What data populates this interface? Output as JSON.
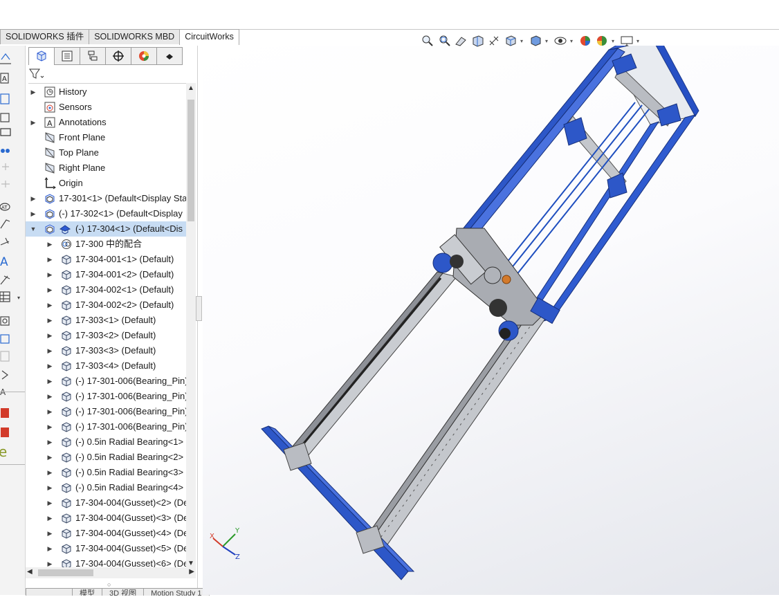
{
  "tabs": [
    {
      "label": "SOLIDWORKS 插件",
      "active": false
    },
    {
      "label": "SOLIDWORKS MBD",
      "active": false
    },
    {
      "label": "CircuitWorks",
      "active": true
    }
  ],
  "view_toolbar": {
    "icons": [
      "zoom-to-fit-icon",
      "zoom-to-area-icon",
      "previous-view-icon",
      "section-view-icon",
      "dynamic-annotation-icon",
      "view-orientation-icon",
      "display-style-icon",
      "hide-show-icon",
      "edit-appearance-icon",
      "apply-scene-icon",
      "view-settings-icon"
    ]
  },
  "feature_manager": {
    "panel_tabs": [
      "featuremanager-tab",
      "propertymanager-tab",
      "configurationmanager-tab",
      "dimxpertmanager-tab",
      "displaymanager-tab",
      "cam-tab"
    ],
    "filter_icon": "filter-icon",
    "tree": [
      {
        "label": "History",
        "icon": "history-icon",
        "expand": "collapsed",
        "level": 0
      },
      {
        "label": "Sensors",
        "icon": "sensors-icon",
        "expand": "none",
        "level": 0
      },
      {
        "label": "Annotations",
        "icon": "annotations-icon",
        "expand": "collapsed",
        "level": 0
      },
      {
        "label": "Front Plane",
        "icon": "plane-icon",
        "expand": "none",
        "level": 0
      },
      {
        "label": "Top Plane",
        "icon": "plane-icon",
        "expand": "none",
        "level": 0
      },
      {
        "label": "Right Plane",
        "icon": "plane-icon",
        "expand": "none",
        "level": 0
      },
      {
        "label": "Origin",
        "icon": "origin-icon",
        "expand": "none",
        "level": 0
      },
      {
        "label": "17-301<1> (Default<Display Sta",
        "icon": "subassembly-icon",
        "expand": "collapsed",
        "level": 0
      },
      {
        "label": "(-) 17-302<1> (Default<Display",
        "icon": "subassembly-icon",
        "expand": "collapsed",
        "level": 0
      },
      {
        "label": "(-) 17-304<1> (Default<Dis",
        "icon": "subassembly-icon",
        "expand": "expanded",
        "level": 0,
        "selected": true
      },
      {
        "label": "17-300 中的配合",
        "icon": "mates-icon",
        "expand": "collapsed",
        "level": 1
      },
      {
        "label": "17-304-001<1> (Default)",
        "icon": "part-icon",
        "expand": "collapsed",
        "level": 1
      },
      {
        "label": "17-304-001<2> (Default)",
        "icon": "part-icon",
        "expand": "collapsed",
        "level": 1
      },
      {
        "label": "17-304-002<1> (Default)",
        "icon": "part-icon",
        "expand": "collapsed",
        "level": 1
      },
      {
        "label": "17-304-002<2> (Default)",
        "icon": "part-icon",
        "expand": "collapsed",
        "level": 1
      },
      {
        "label": "17-303<1> (Default)",
        "icon": "part-icon",
        "expand": "collapsed",
        "level": 1
      },
      {
        "label": "17-303<2> (Default)",
        "icon": "part-icon",
        "expand": "collapsed",
        "level": 1
      },
      {
        "label": "17-303<3> (Default)",
        "icon": "part-icon",
        "expand": "collapsed",
        "level": 1
      },
      {
        "label": "17-303<4> (Default)",
        "icon": "part-icon",
        "expand": "collapsed",
        "level": 1
      },
      {
        "label": "(-) 17-301-006(Bearing_Pin)",
        "icon": "part-icon",
        "expand": "collapsed",
        "level": 1
      },
      {
        "label": "(-) 17-301-006(Bearing_Pin)",
        "icon": "part-icon",
        "expand": "collapsed",
        "level": 1
      },
      {
        "label": "(-) 17-301-006(Bearing_Pin)",
        "icon": "part-icon",
        "expand": "collapsed",
        "level": 1
      },
      {
        "label": "(-) 17-301-006(Bearing_Pin)",
        "icon": "part-icon",
        "expand": "collapsed",
        "level": 1
      },
      {
        "label": "(-) 0.5in Radial Bearing<1>",
        "icon": "part-icon",
        "expand": "collapsed",
        "level": 1
      },
      {
        "label": "(-) 0.5in Radial Bearing<2>",
        "icon": "part-icon",
        "expand": "collapsed",
        "level": 1
      },
      {
        "label": "(-) 0.5in Radial Bearing<3>",
        "icon": "part-icon",
        "expand": "collapsed",
        "level": 1
      },
      {
        "label": "(-) 0.5in Radial Bearing<4>",
        "icon": "part-icon",
        "expand": "collapsed",
        "level": 1
      },
      {
        "label": "17-304-004(Gusset)<2> (De",
        "icon": "part-icon",
        "expand": "collapsed",
        "level": 1
      },
      {
        "label": "17-304-004(Gusset)<3> (De",
        "icon": "part-icon",
        "expand": "collapsed",
        "level": 1
      },
      {
        "label": "17-304-004(Gusset)<4> (De",
        "icon": "part-icon",
        "expand": "collapsed",
        "level": 1
      },
      {
        "label": "17-304-004(Gusset)<5> (De",
        "icon": "part-icon",
        "expand": "collapsed",
        "level": 1
      },
      {
        "label": "17-304-004(Gusset)<6> (De",
        "icon": "part-icon",
        "expand": "collapsed",
        "level": 1
      }
    ]
  },
  "bottom_tabs": [
    "",
    "模型",
    "3D 视图",
    "Motion Study 1"
  ],
  "triad": {
    "x": "X",
    "y": "Y",
    "z": "Z"
  },
  "colors": {
    "accent_blue": "#2d5bd3",
    "frame_blue": "#1f4fbf",
    "aluminum": "#b9bcc2",
    "selection": "#c7dcf3"
  }
}
